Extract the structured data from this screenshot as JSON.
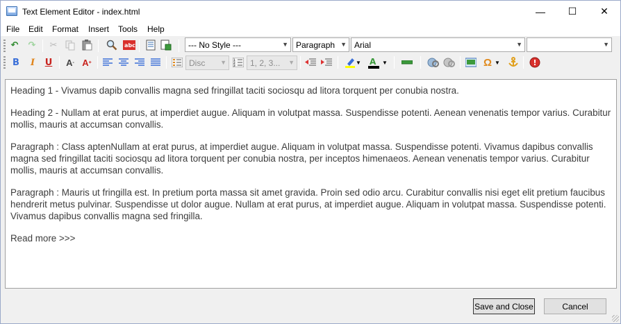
{
  "window": {
    "title": "Text Element Editor - index.html",
    "minimize_glyph": "—",
    "maximize_glyph": "☐",
    "close_glyph": "✕"
  },
  "menu": [
    "File",
    "Edit",
    "Format",
    "Insert",
    "Tools",
    "Help"
  ],
  "toolbar": {
    "style_select": "--- No Style ---",
    "block_select": "Paragraph",
    "font_select": "Arial",
    "size_select": "",
    "list_style_select": "Disc",
    "numbering_select": "1, 2, 3...",
    "bold_glyph": "B",
    "italic_glyph": "I",
    "underline_glyph": "U",
    "font_color": "#000000",
    "highlight_color": "#ffff00"
  },
  "content": {
    "paragraphs": [
      "Heading 1 - Vivamus dapib convallis magna sed fringillat taciti sociosqu ad litora torquent per conubia nostra.",
      "Heading 2 - Nullam at erat purus, at imperdiet augue. Aliquam in volutpat massa. Suspendisse potenti. Aenean venenatis tempor varius. Curabitur mollis, mauris at accumsan convallis.",
      "Paragraph : Class aptenNullam at erat purus, at imperdiet augue. Aliquam in volutpat massa. Suspendisse potenti. Vivamus dapibus convallis magna sed fringillat taciti sociosqu ad litora torquent per conubia nostra, per inceptos himenaeos. Aenean venenatis tempor varius. Curabitur mollis, mauris at accumsan convallis.",
      "Paragraph : Mauris ut fringilla est. In pretium porta massa sit amet gravida. Proin sed odio arcu. Curabitur convallis nisi eget elit pretium faucibus hendrerit metus pulvinar. Suspendisse ut dolor augue. Nullam at erat purus, at imperdiet augue. Aliquam in volutpat massa. Suspendisse potenti. Vivamus dapibus convallis magna sed fringilla."
    ],
    "read_more": "Read more >>>"
  },
  "buttons": {
    "save_close": "Save and Close",
    "cancel": "Cancel"
  }
}
